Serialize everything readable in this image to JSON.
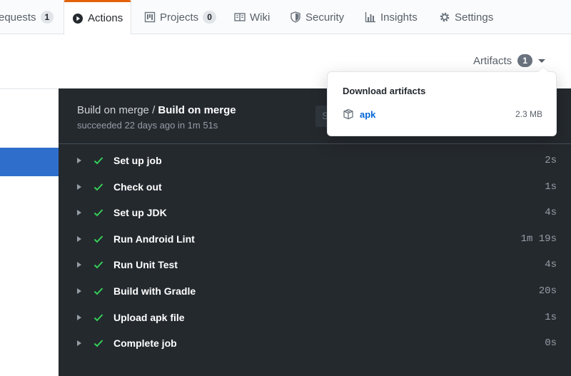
{
  "tabs": [
    {
      "label": "equests",
      "count": "1",
      "icon": "pull-request-icon"
    },
    {
      "label": "Actions",
      "icon": "play-icon"
    },
    {
      "label": "Projects",
      "count": "0",
      "icon": "project-icon"
    },
    {
      "label": "Wiki",
      "icon": "book-icon"
    },
    {
      "label": "Security",
      "icon": "shield-icon"
    },
    {
      "label": "Insights",
      "icon": "graph-icon"
    },
    {
      "label": "Settings",
      "icon": "gear-icon"
    }
  ],
  "artifacts": {
    "label": "Artifacts",
    "count": "1",
    "dropdown_title": "Download artifacts",
    "items": [
      {
        "name": "apk",
        "size": "2.3 MB",
        "icon": "package-icon"
      }
    ]
  },
  "job": {
    "workflow": "Build on merge",
    "separator": " / ",
    "name": "Build on merge",
    "status": "succeeded 22 days ago in 1m 51s",
    "search_hint": "S"
  },
  "steps": [
    {
      "name": "Set up job",
      "duration": "2s"
    },
    {
      "name": "Check out",
      "duration": "1s"
    },
    {
      "name": "Set up JDK",
      "duration": "4s"
    },
    {
      "name": "Run Android Lint",
      "duration": "1m 19s"
    },
    {
      "name": "Run Unit Test",
      "duration": "4s"
    },
    {
      "name": "Build with Gradle",
      "duration": "20s"
    },
    {
      "name": "Upload apk file",
      "duration": "1s"
    },
    {
      "name": "Complete job",
      "duration": "0s"
    }
  ],
  "colors": {
    "accent_tab": "#e36209",
    "success": "#34d058",
    "link": "#0366d6",
    "log_bg": "#24292e",
    "sidebar_active": "#2f6fcb"
  }
}
